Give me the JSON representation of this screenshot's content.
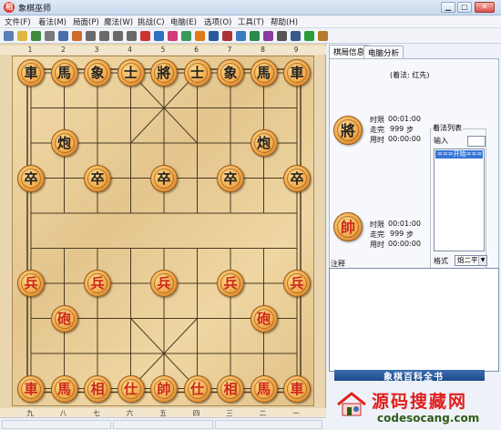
{
  "window": {
    "title": "象棋巫师",
    "app_icon": "相",
    "min": "▁",
    "max": "□",
    "close": "✕"
  },
  "menu": [
    "文件(F)",
    "着法(M)",
    "局面(P)",
    "魔法(W)",
    "挑战(C)",
    "电脑(E)",
    "选项(O)",
    "工具(T)",
    "帮助(H)"
  ],
  "toolbar_icons": [
    "new-icon",
    "open-icon",
    "save-icon",
    "print-icon",
    "copy-icon",
    "paste-icon",
    "first-move-icon",
    "prev-move-icon",
    "next-move-icon",
    "last-move-icon",
    "stop-icon",
    "computer-move-icon",
    "flip-board-icon",
    "edit-position-icon",
    "settings-icon",
    "sound-icon",
    "book-icon",
    "engine-icon",
    "hint-icon",
    "library-icon",
    "clock-icon",
    "sheet-icon",
    "chart-icon",
    "export-icon"
  ],
  "board": {
    "top_ruler": [
      "1",
      "2",
      "3",
      "4",
      "5",
      "6",
      "7",
      "8",
      "9"
    ],
    "bottom_ruler": [
      "九",
      "八",
      "七",
      "六",
      "五",
      "四",
      "三",
      "二",
      "一"
    ],
    "pieces": [
      {
        "name": "black-chariot-1",
        "char": "車",
        "color": "black",
        "c": 0,
        "r": 0
      },
      {
        "name": "black-horse-1",
        "char": "馬",
        "color": "black",
        "c": 1,
        "r": 0
      },
      {
        "name": "black-elephant-1",
        "char": "象",
        "color": "black",
        "c": 2,
        "r": 0
      },
      {
        "name": "black-advisor-1",
        "char": "士",
        "color": "black",
        "c": 3,
        "r": 0
      },
      {
        "name": "black-general",
        "char": "將",
        "color": "black",
        "c": 4,
        "r": 0
      },
      {
        "name": "black-advisor-2",
        "char": "士",
        "color": "black",
        "c": 5,
        "r": 0
      },
      {
        "name": "black-elephant-2",
        "char": "象",
        "color": "black",
        "c": 6,
        "r": 0
      },
      {
        "name": "black-horse-2",
        "char": "馬",
        "color": "black",
        "c": 7,
        "r": 0
      },
      {
        "name": "black-chariot-2",
        "char": "車",
        "color": "black",
        "c": 8,
        "r": 0
      },
      {
        "name": "black-cannon-1",
        "char": "炮",
        "color": "black",
        "c": 1,
        "r": 2
      },
      {
        "name": "black-cannon-2",
        "char": "炮",
        "color": "black",
        "c": 7,
        "r": 2
      },
      {
        "name": "black-soldier-1",
        "char": "卒",
        "color": "black",
        "c": 0,
        "r": 3
      },
      {
        "name": "black-soldier-2",
        "char": "卒",
        "color": "black",
        "c": 2,
        "r": 3
      },
      {
        "name": "black-soldier-3",
        "char": "卒",
        "color": "black",
        "c": 4,
        "r": 3
      },
      {
        "name": "black-soldier-4",
        "char": "卒",
        "color": "black",
        "c": 6,
        "r": 3
      },
      {
        "name": "black-soldier-5",
        "char": "卒",
        "color": "black",
        "c": 8,
        "r": 3
      },
      {
        "name": "red-soldier-1",
        "char": "兵",
        "color": "red",
        "c": 0,
        "r": 6
      },
      {
        "name": "red-soldier-2",
        "char": "兵",
        "color": "red",
        "c": 2,
        "r": 6
      },
      {
        "name": "red-soldier-3",
        "char": "兵",
        "color": "red",
        "c": 4,
        "r": 6
      },
      {
        "name": "red-soldier-4",
        "char": "兵",
        "color": "red",
        "c": 6,
        "r": 6
      },
      {
        "name": "red-soldier-5",
        "char": "兵",
        "color": "red",
        "c": 8,
        "r": 6
      },
      {
        "name": "red-cannon-1",
        "char": "砲",
        "color": "red",
        "c": 1,
        "r": 7
      },
      {
        "name": "red-cannon-2",
        "char": "砲",
        "color": "red",
        "c": 7,
        "r": 7
      },
      {
        "name": "red-chariot-1",
        "char": "車",
        "color": "red",
        "c": 0,
        "r": 9
      },
      {
        "name": "red-horse-1",
        "char": "馬",
        "color": "red",
        "c": 1,
        "r": 9
      },
      {
        "name": "red-elephant-1",
        "char": "相",
        "color": "red",
        "c": 2,
        "r": 9
      },
      {
        "name": "red-advisor-1",
        "char": "仕",
        "color": "red",
        "c": 3,
        "r": 9
      },
      {
        "name": "red-general",
        "char": "帥",
        "color": "red",
        "c": 4,
        "r": 9
      },
      {
        "name": "red-advisor-2",
        "char": "仕",
        "color": "red",
        "c": 5,
        "r": 9
      },
      {
        "name": "red-elephant-2",
        "char": "相",
        "color": "red",
        "c": 6,
        "r": 9
      },
      {
        "name": "red-horse-2",
        "char": "馬",
        "color": "red",
        "c": 7,
        "r": 9
      },
      {
        "name": "red-chariot-2",
        "char": "車",
        "color": "red",
        "c": 8,
        "r": 9
      }
    ]
  },
  "panel": {
    "tabs": [
      "棋局信息",
      "电脑分析"
    ],
    "turn": "(着法: 红先)",
    "black": {
      "piece": "將",
      "time_limit_label": "时限",
      "time_limit": "00:01:00",
      "moves_label": "走完",
      "moves": "999",
      "moves_unit": "步",
      "used_label": "用时",
      "used": "00:00:00"
    },
    "red": {
      "piece": "帥",
      "time_limit_label": "时限",
      "time_limit": "00:01:00",
      "moves_label": "走完",
      "moves": "999",
      "moves_unit": "步",
      "used_label": "用时",
      "used": "00:00:00"
    },
    "move_list": {
      "title": "着法列表",
      "input_label": "输入",
      "selected": "===开始===",
      "format_label": "格式",
      "format_value": "炮二平"
    },
    "notes_label": "注释",
    "ad_text": "象棋百科全书"
  },
  "watermark": {
    "main": "源码搜藏网",
    "sub": "codesocang.com"
  },
  "colors": {
    "red_text": "#c9281c",
    "black_text": "#222222",
    "board_wood": "#e4c58d",
    "watermark_red": "#e1201d"
  }
}
